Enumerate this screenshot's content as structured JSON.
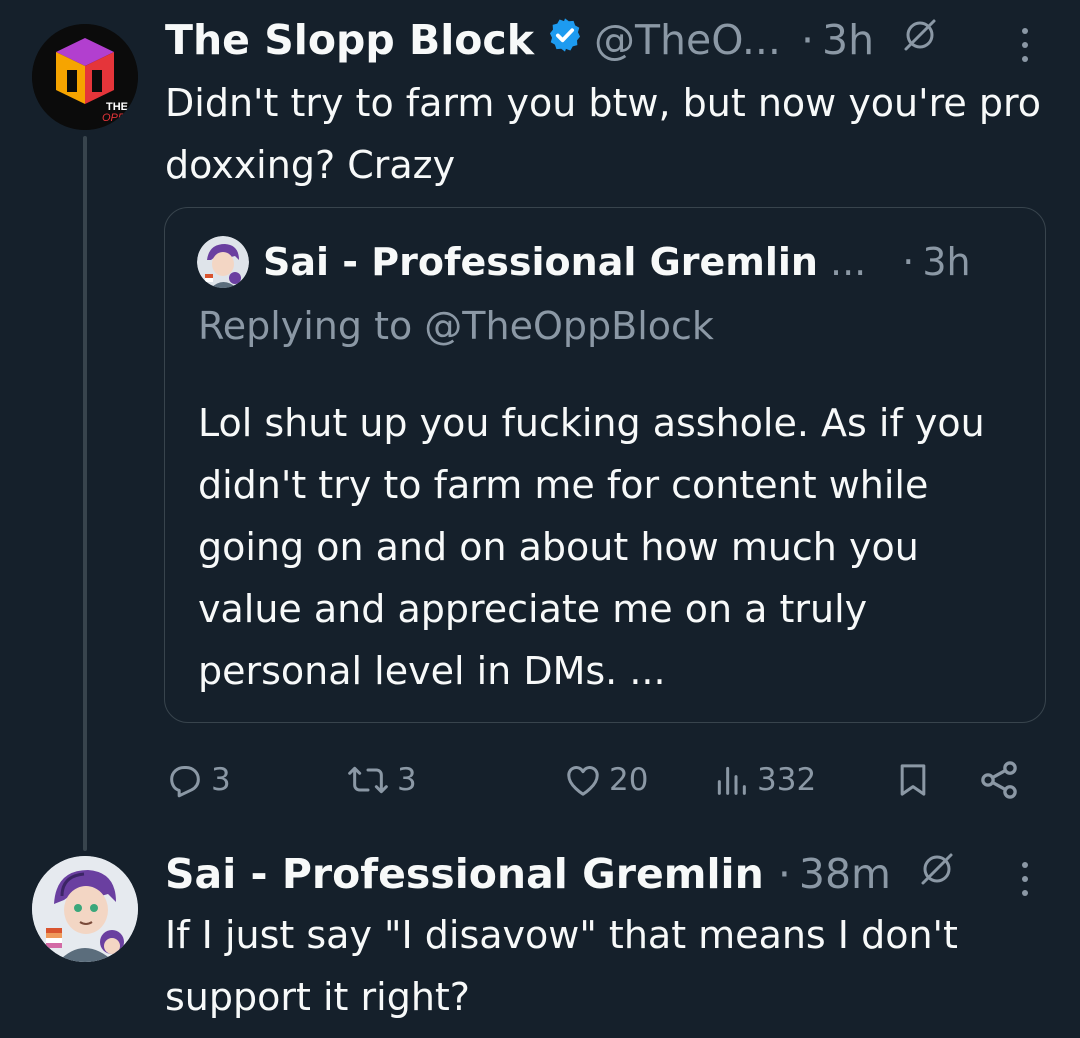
{
  "tweet1": {
    "author_name": "The Slopp Block",
    "handle": "@TheO...",
    "separator": "·",
    "time": "3h",
    "text": "Didn't try to farm you btw, but now you're pro doxxing? Crazy",
    "quote": {
      "author_name": "Sai - Professional Gremlin",
      "ellipsis": "...",
      "separator": "·",
      "time": "3h",
      "replying_to": "Replying to @TheOppBlock",
      "text": "Lol shut up you fucking asshole. As if you didn't try to farm me for content while going on and on about how much you value and appreciate me on a truly personal level in DMs. ..."
    },
    "actions": {
      "replies": "3",
      "reposts": "3",
      "likes": "20",
      "views": "332"
    }
  },
  "tweet2": {
    "author_name": "Sai - Professional Gremlin",
    "separator": "·",
    "time": "38m",
    "text": "If I just say \"I disavow\" that means I don't support it right?"
  },
  "colors": {
    "background": "#15202b",
    "text": "#f7f9f9",
    "muted": "#8b98a5",
    "border": "#38444d",
    "verified": "#1d9bf0"
  }
}
